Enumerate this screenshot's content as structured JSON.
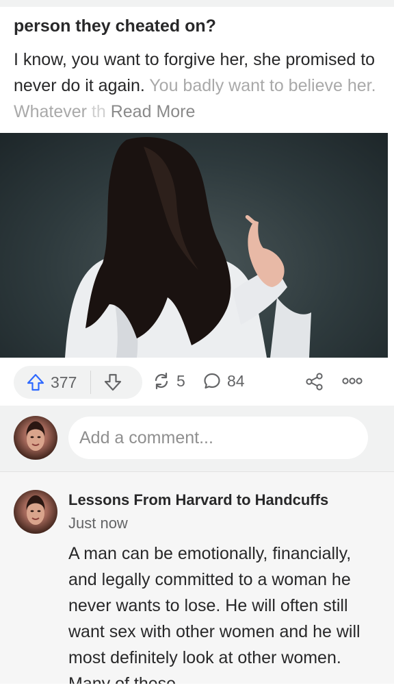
{
  "post": {
    "title": "person they cheated on?",
    "excerpt_main": "I know, you want to forgive her, she promised to never do it again.",
    "excerpt_fade1": " You badly want to believe her. Whatever",
    "excerpt_fade2": " th",
    "read_more": " Read More"
  },
  "actions": {
    "upvote_count": "377",
    "reshare_count": "5",
    "comment_count": "84"
  },
  "comment_box": {
    "placeholder": "Add a comment..."
  },
  "comments": [
    {
      "author": "Lessons From Harvard to Handcuffs",
      "time": "Just now",
      "text": "A man can be emotionally, financially, and legally committed to a woman he never wants to lose. He will often still want sex with other women and he will most definitely look at other women. Many of these"
    }
  ],
  "colors": {
    "accent_blue": "#2e69ff",
    "icon_gray": "#636466"
  }
}
